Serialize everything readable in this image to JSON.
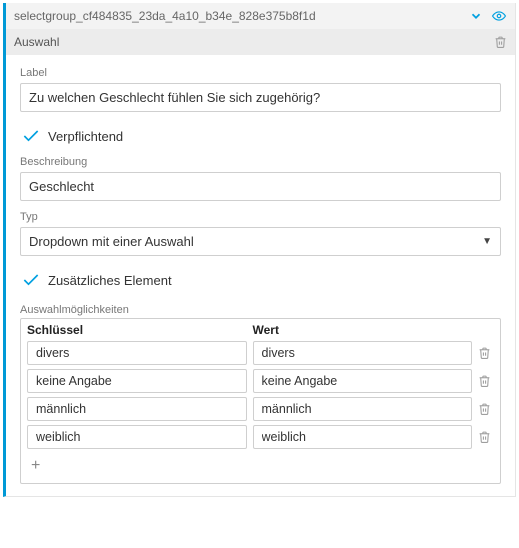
{
  "header": {
    "id": "selectgroup_cf484835_23da_4a10_b34e_828e375b8f1d",
    "subtitle": "Auswahl"
  },
  "fields": {
    "label_caption": "Label",
    "label_value": "Zu welchen Geschlecht fühlen Sie sich zugehörig?",
    "mandatory_label": "Verpflichtend",
    "mandatory_checked": true,
    "description_caption": "Beschreibung",
    "description_value": "Geschlecht",
    "type_caption": "Typ",
    "type_value": "Dropdown mit einer Auswahl",
    "extra_label": "Zusätzliches Element",
    "extra_checked": true
  },
  "options_table": {
    "caption": "Auswahlmöglichkeiten",
    "col_key": "Schlüssel",
    "col_val": "Wert",
    "rows": [
      {
        "key": "divers",
        "val": "divers"
      },
      {
        "key": "keine Angabe",
        "val": "keine Angabe"
      },
      {
        "key": "männlich",
        "val": "männlich"
      },
      {
        "key": "weiblich",
        "val": "weiblich"
      }
    ],
    "add_label": "+"
  },
  "icons": {
    "collapse": "⌄",
    "visibility": "👁",
    "delete": "🗑"
  }
}
